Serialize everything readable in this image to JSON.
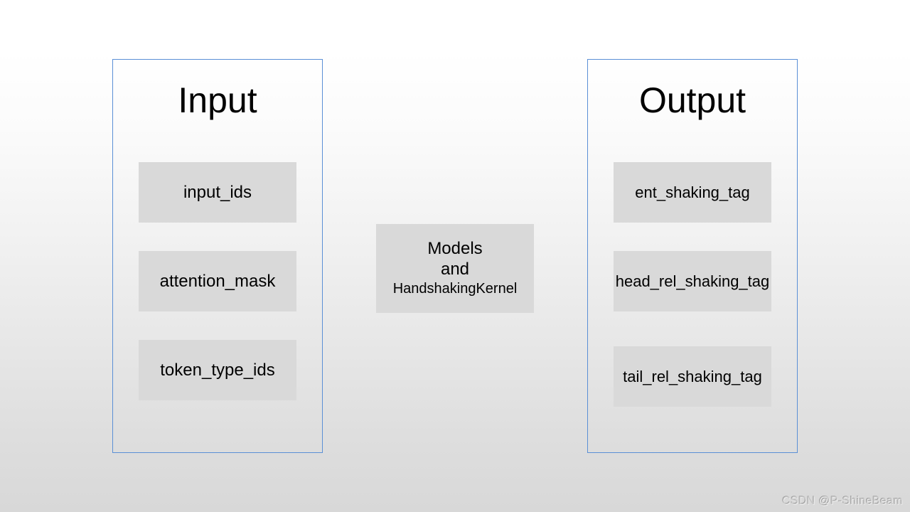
{
  "input": {
    "title": "Input",
    "items": [
      "input_ids",
      "attention_mask",
      "token_type_ids"
    ]
  },
  "center": {
    "line1": "Models",
    "line2": "and",
    "line3": "HandshakingKernel"
  },
  "output": {
    "title": "Output",
    "items": [
      "ent_shaking_tag",
      "head_rel_shaking_tag",
      "tail_rel_shaking_tag"
    ]
  },
  "watermark": "CSDN @P-ShineBeam"
}
